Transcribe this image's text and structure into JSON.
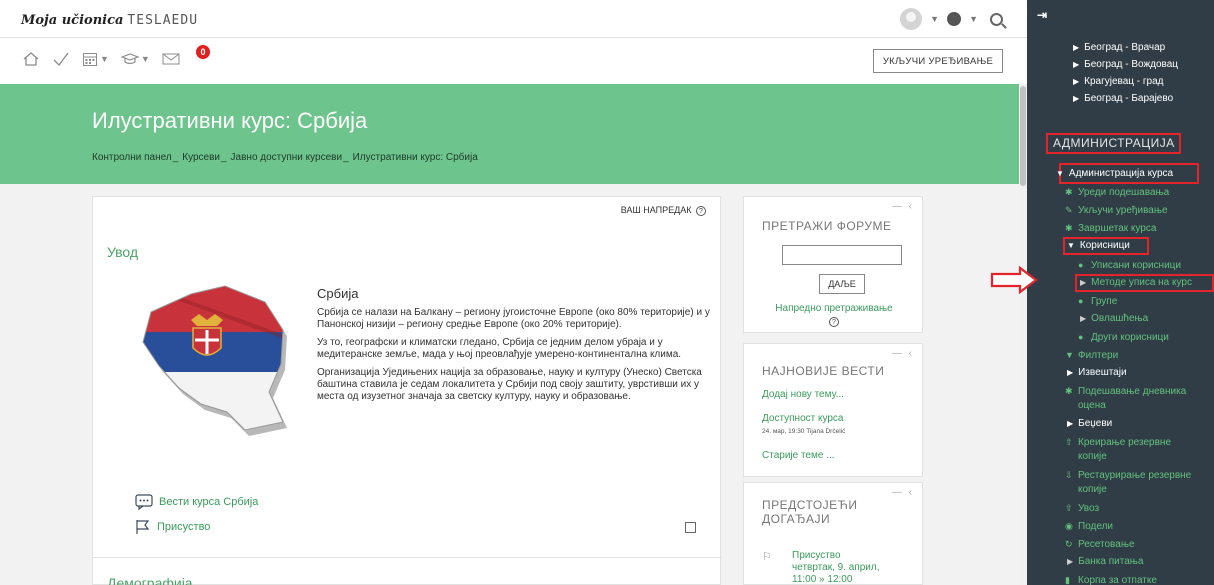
{
  "logo": {
    "part1": "Moja učionica",
    "part2": "TESLAEDU"
  },
  "toolbar": {
    "edit_label": "УКЉУЧИ УРЕЂИВАЊЕ",
    "notifications_count": "0"
  },
  "header": {
    "title": "Илустративни курс: Србија",
    "breadcrumbs": [
      "Контролни панел",
      "Курсеви",
      "Јавно доступни курсеви",
      "Илустративни курс: Србија"
    ]
  },
  "course": {
    "progress_label": "ВАШ НАПРЕДАК",
    "section_title": "Увод",
    "intro_heading": "Србија",
    "paragraphs": [
      "Србија се налази на Балкану – региону југоисточне Европе (око 80% територије) и у Панонској низији – региону средње Европе (око 20% територије).",
      "Уз то, географски и климатски гледано, Србија се једним делом убраја и у медитеранске земље, мада у њој преовлађује умерено-континентална клима.",
      "Организација Уједињених нација за образовање, науку и културу (Унеско) Светска баштина ставила је седам локалитета у Србији под своју заштиту, уврстивши их у места од изузетног значаја за светску културу, науку и образовање."
    ],
    "activity_news": "Вести курса Србија",
    "activity_attendance": "Присуство",
    "next_section": "Демографија"
  },
  "blocks": {
    "search": {
      "title": "ПРЕТРАЖИ ФОРУМЕ",
      "button": "ДАЉЕ",
      "advanced": "Напредно претраживање"
    },
    "news": {
      "title": "НАЈНОВИЈЕ ВЕСТИ",
      "add": "Додај нову тему...",
      "item_title": "Доступност курса",
      "item_meta": "24. мар, 19:30  Tijana Drčelić",
      "older": "Старије теме ..."
    },
    "events": {
      "title_line1": "ПРЕДСТОЈЕЋИ",
      "title_line2": "ДОГАЂАЈИ",
      "event_name": "Присуство",
      "event_date": "четвртак, 9. април,",
      "event_time": "11:00 » 12:00"
    }
  },
  "sidebar": {
    "courses": [
      "Београд - Врачар",
      "Београд - Вождовац",
      "Крагујевац - град",
      "Београд - Барајево"
    ],
    "admin_heading": "АДМИНИСТРАЦИЈА",
    "course_admin": "Администрација курса",
    "edit_settings": "Уреди подешавања",
    "turn_edit": "Укључи уређивање",
    "completion": "Завршетак курса",
    "users": "Корисници",
    "enrolled": "Уписани корисници",
    "enrol_methods": "Методе уписа на курс",
    "groups": "Групе",
    "permissions": "Овлашћења",
    "other_users": "Други корисници",
    "filters": "Филтери",
    "reports": "Извештаји",
    "gradebook_1": "Подешавање дневника",
    "gradebook_2": "оцена",
    "badges": "Беџеви",
    "backup_1": "Креирање резервне",
    "backup_2": "копије",
    "restore_1": "Рестаурирање резервне",
    "restore_2": "копије",
    "import": "Увоз",
    "share": "Подели",
    "reset": "Ресетовање",
    "question_bank": "Банка питања",
    "recycle": "Корпа за отпатке"
  },
  "colors": {
    "header_green": "#6dc48c",
    "sidebar_bg": "#303d47",
    "link_green": "#63c17c",
    "highlight_red": "#e3242b"
  }
}
